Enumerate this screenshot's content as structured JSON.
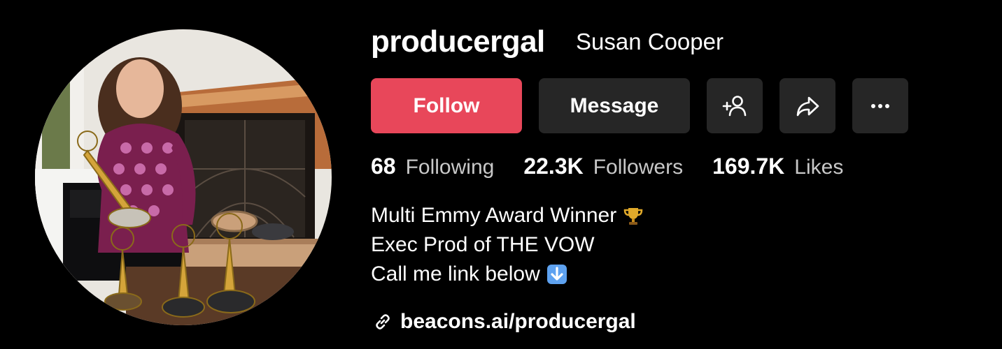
{
  "profile": {
    "username": "producergal",
    "display_name": "Susan Cooper"
  },
  "actions": {
    "follow_label": "Follow",
    "message_label": "Message",
    "follow_color": "#e8475a",
    "secondary_color": "#262626",
    "icons": [
      "add-friend-icon",
      "share-icon",
      "more-icon"
    ]
  },
  "stats": [
    {
      "value": "68",
      "label": "Following"
    },
    {
      "value": "22.3K",
      "label": "Followers"
    },
    {
      "value": "169.7K",
      "label": "Likes"
    }
  ],
  "bio": {
    "line1": "Multi Emmy Award Winner",
    "line1_emoji": "trophy-emoji",
    "line2": "Exec Prod of THE VOW",
    "line3": "Call me link below",
    "line3_emoji": "down-arrow-emoji"
  },
  "link": {
    "text": "beacons.ai/producergal",
    "icon": "link-icon"
  }
}
